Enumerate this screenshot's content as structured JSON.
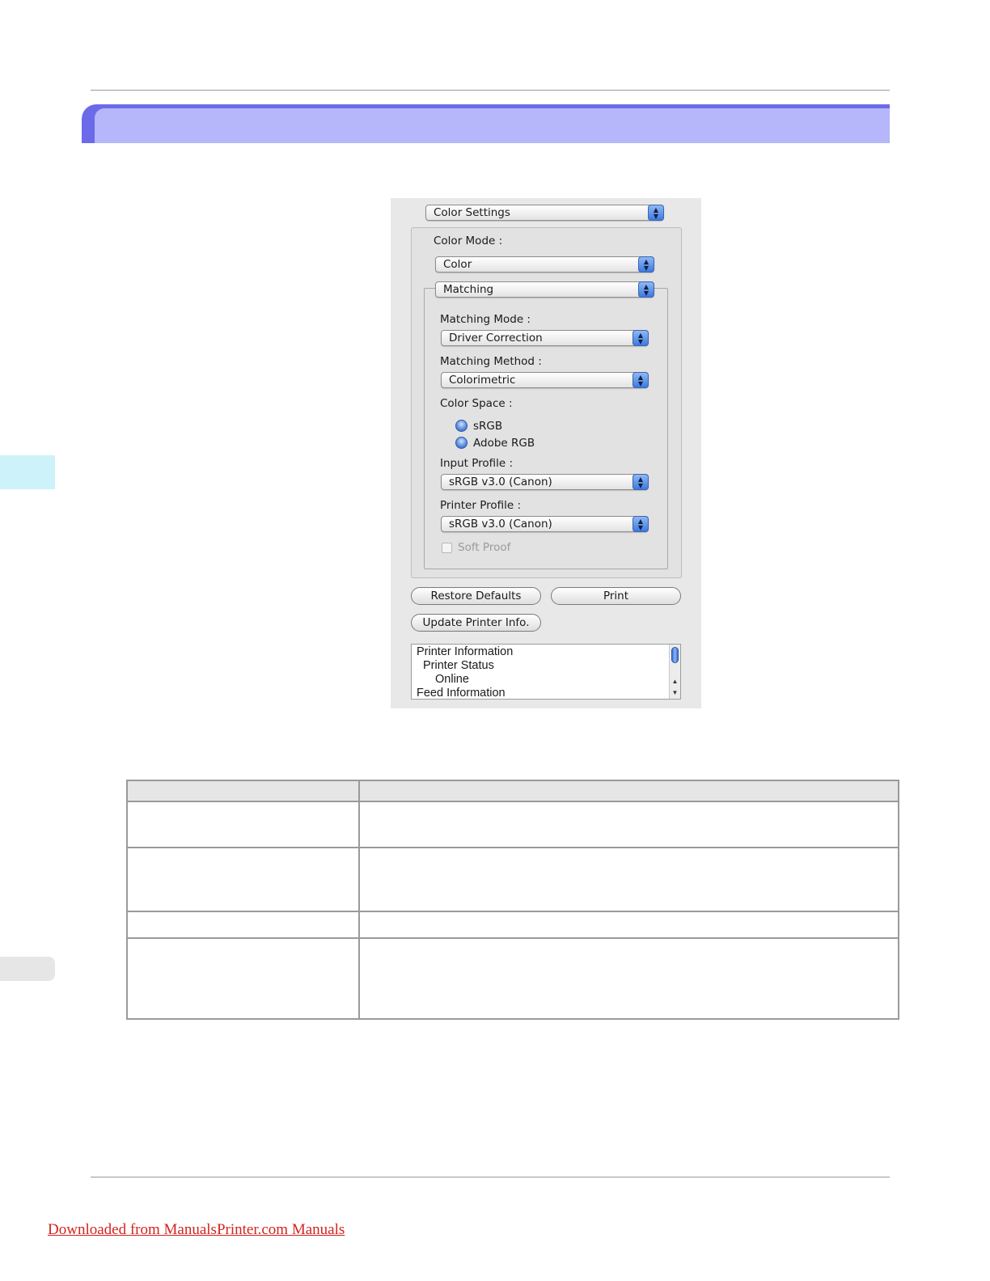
{
  "dialog": {
    "panel_select": "Color Settings",
    "color_mode_label": "Color Mode :",
    "color_mode_value": "Color",
    "matching_select": "Matching",
    "matching_mode_label": "Matching Mode :",
    "matching_mode_value": "Driver Correction",
    "matching_method_label": "Matching Method :",
    "matching_method_value": "Colorimetric",
    "color_space_label": "Color Space :",
    "color_space_options": [
      "sRGB",
      "Adobe RGB"
    ],
    "input_profile_label": "Input Profile :",
    "input_profile_value": "sRGB v3.0 (Canon)",
    "printer_profile_label": "Printer Profile :",
    "printer_profile_value": "sRGB v3.0 (Canon)",
    "soft_proof_label": "Soft Proof",
    "restore_defaults_label": "Restore Defaults",
    "print_label": "Print",
    "update_printer_info_label": "Update Printer Info.",
    "info_list": [
      "Printer Information",
      "Printer Status",
      "Online",
      "Feed Information"
    ]
  },
  "footer": {
    "link_text": "Downloaded from ManualsPrinter.com Manuals"
  },
  "colors": {
    "banner_outer": "#6b6bea",
    "banner_inner": "#b6b6fb",
    "link": "#d4231f"
  }
}
